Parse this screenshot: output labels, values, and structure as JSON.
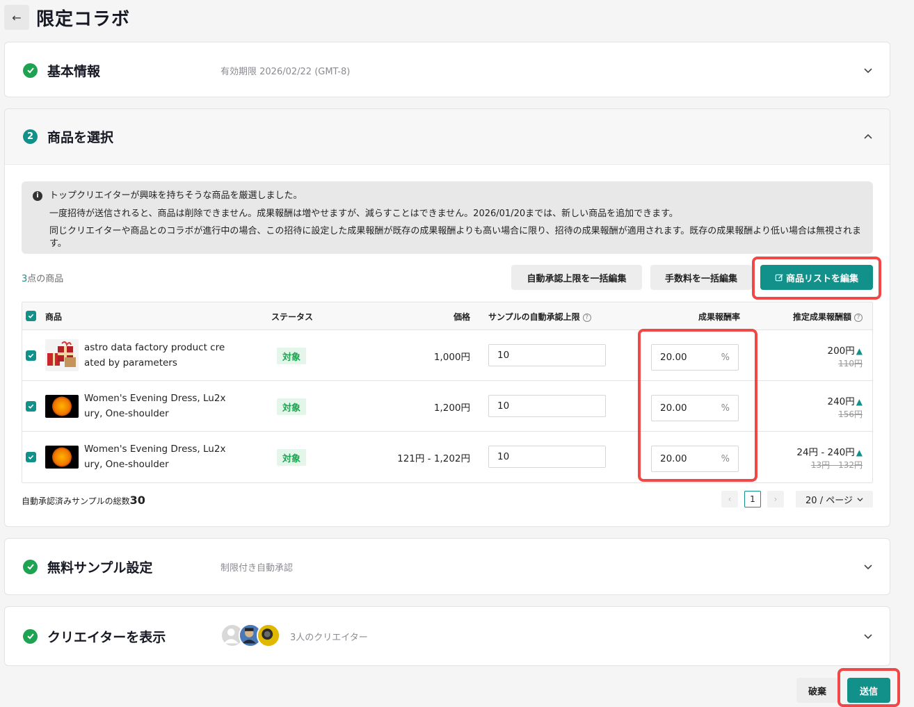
{
  "header": {
    "back_icon": "arrow-left-icon",
    "title": "限定コラボ"
  },
  "basic": {
    "title": "基本情報",
    "subtitle": "有効期限 2026/02/22 (GMT-8)"
  },
  "products": {
    "step": "2",
    "title": "商品を選択",
    "notice": [
      "トップクリエイターが興味を持ちそうな商品を厳選しました。",
      "一度招待が送信されると、商品は削除できません。成果報酬は増やせますが、減らすことはできません。2026/01/20までは、新しい商品を追加できます。",
      "同じクリエイターや商品とのコラボが進行中の場合、この招待に設定した成果報酬が既存の成果報酬よりも高い場合に限り、招待の成果報酬が適用されます。既存の成果報酬より低い場合は無視されます。"
    ],
    "count_num": "3",
    "count_label": "点の商品",
    "btn_bulk_limit": "自動承認上限を一括編集",
    "btn_bulk_fee": "手数料を一括編集",
    "btn_edit_list": "商品リストを編集",
    "columns": {
      "product": "商品",
      "status": "ステータス",
      "price": "価格",
      "sample_limit": "サンプルの自動承認上限",
      "commission": "成果報酬率",
      "estimated": "推定成果報酬額"
    },
    "rows": [
      {
        "name": "astro data factory product created by parameters",
        "status": "対象",
        "price": "1,000円",
        "limit": "10",
        "rate": "20.00",
        "rate_unit": "%",
        "est": "200円",
        "est_old": "110円"
      },
      {
        "name": "Women's Evening Dress, Lu2xury, One-shoulder",
        "status": "対象",
        "price": "1,200円",
        "limit": "10",
        "rate": "20.00",
        "rate_unit": "%",
        "est": "240円",
        "est_old": "156円"
      },
      {
        "name": "Women's Evening Dress, Lu2xury, One-shoulder",
        "status": "対象",
        "price": "121円 - 1,202円",
        "limit": "10",
        "rate": "20.00",
        "rate_unit": "%",
        "est": "24円 - 240円",
        "est_old": "13円 - 132円"
      }
    ],
    "total_label": "自動承認済みサンプルの総数",
    "total_value": "30",
    "page": "1",
    "page_size": "20 / ページ"
  },
  "samples": {
    "title": "無料サンプル設定",
    "subtitle": "制限付き自動承認"
  },
  "creators": {
    "title": "クリエイターを表示",
    "subtitle": "3人のクリエイター"
  },
  "footer": {
    "discard": "破棄",
    "send": "送信"
  },
  "colors": {
    "accent": "#12918b",
    "success": "#1ea352",
    "highlight": "#f04747"
  }
}
